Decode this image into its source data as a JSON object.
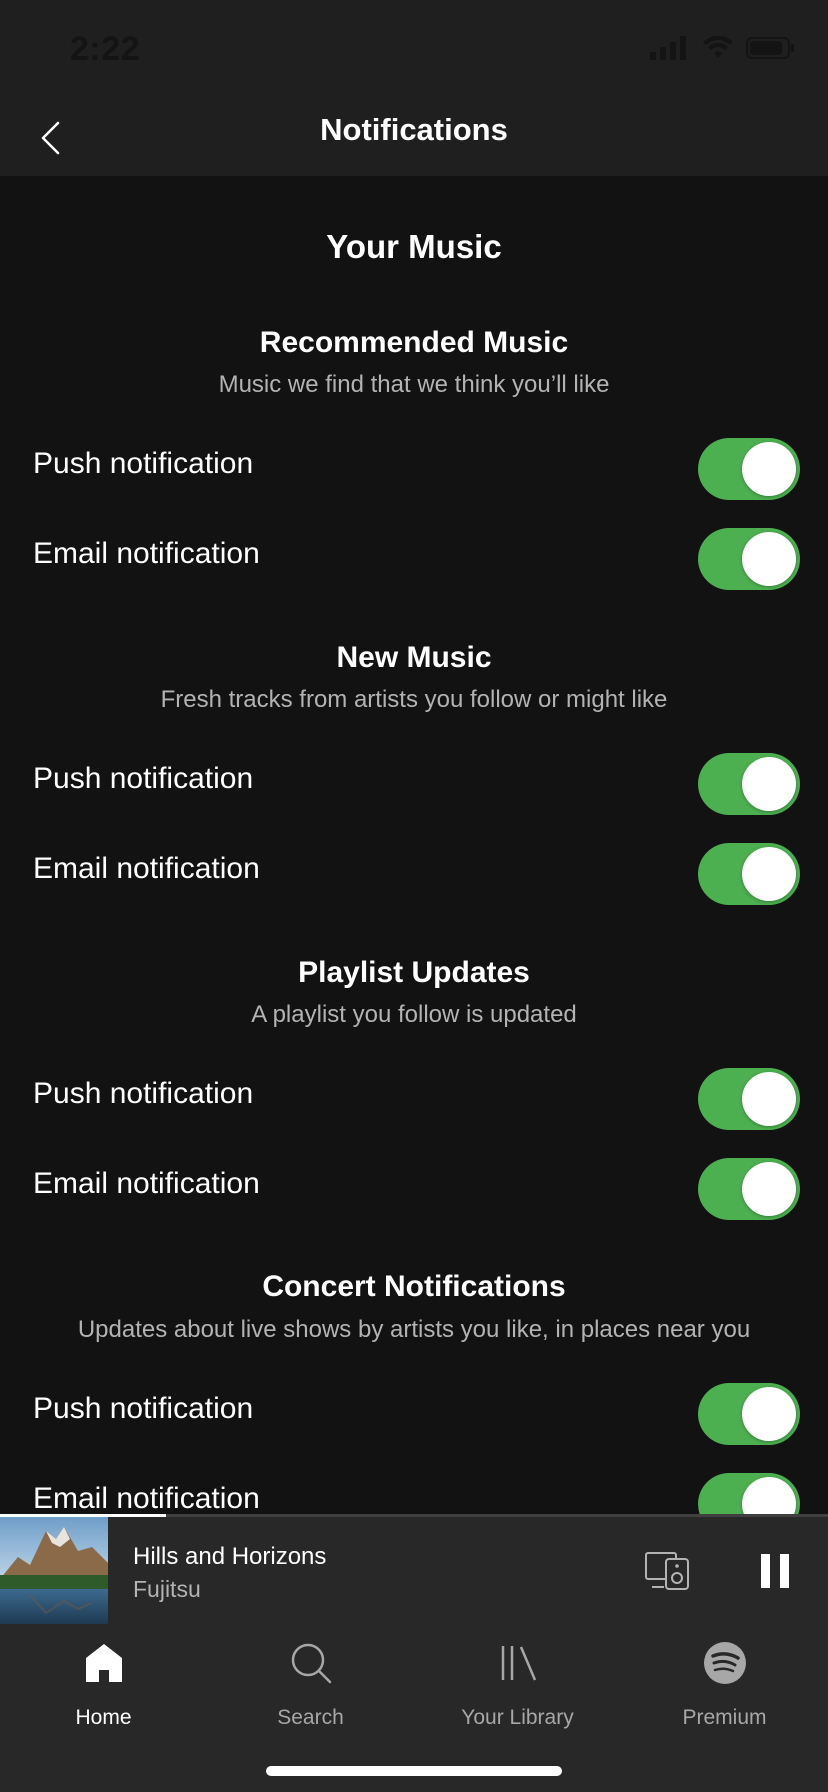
{
  "status_bar": {
    "time": "2:22"
  },
  "header": {
    "title": "Notifications"
  },
  "section": {
    "title": "Your Music"
  },
  "groups": [
    {
      "title": "Recommended Music",
      "subtitle": "Music we find that we think you’ll like",
      "rows": [
        {
          "label": "Push notification",
          "on": true
        },
        {
          "label": "Email notification",
          "on": true
        }
      ]
    },
    {
      "title": "New Music",
      "subtitle": "Fresh tracks from artists you follow or might like",
      "rows": [
        {
          "label": "Push notification",
          "on": true
        },
        {
          "label": "Email notification",
          "on": true
        }
      ]
    },
    {
      "title": "Playlist Updates",
      "subtitle": "A playlist you follow is updated",
      "rows": [
        {
          "label": "Push notification",
          "on": true
        },
        {
          "label": "Email notification",
          "on": true
        }
      ]
    },
    {
      "title": "Concert Notifications",
      "subtitle": "Updates about live shows by artists you like, in places near you",
      "rows": [
        {
          "label": "Push notification",
          "on": true
        },
        {
          "label": "Email notification",
          "on": true
        }
      ]
    }
  ],
  "now_playing": {
    "title": "Hills and Horizons",
    "artist": "Fujitsu",
    "progress": 0.2
  },
  "tabs": [
    {
      "label": "Home",
      "icon": "home-icon",
      "active": true
    },
    {
      "label": "Search",
      "icon": "search-icon",
      "active": false
    },
    {
      "label": "Your Library",
      "icon": "library-icon",
      "active": false
    },
    {
      "label": "Premium",
      "icon": "spotify-logo-icon",
      "active": false
    }
  ],
  "colors": {
    "toggle_on": "#4caf50",
    "background": "#121212",
    "bar": "#282828"
  }
}
